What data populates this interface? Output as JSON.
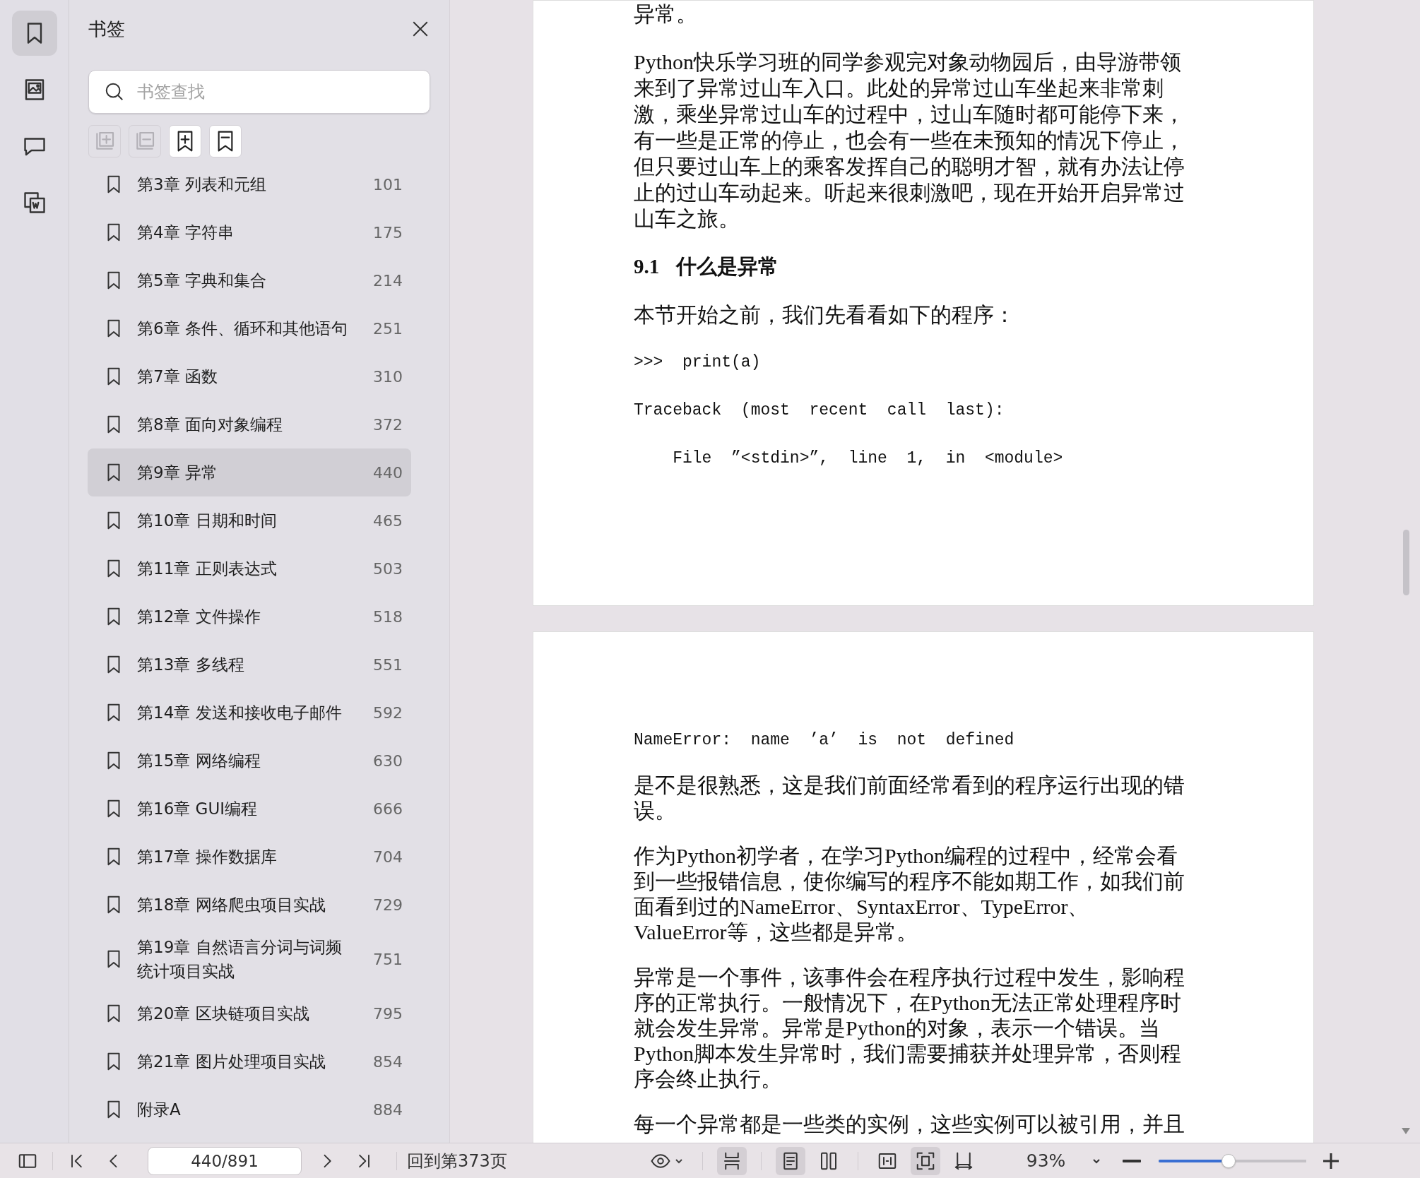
{
  "rail": [
    {
      "kind": "bookmark",
      "selected": true
    },
    {
      "kind": "image",
      "selected": false
    },
    {
      "kind": "comment",
      "selected": false
    },
    {
      "kind": "convert",
      "selected": false
    }
  ],
  "sidebar": {
    "title": "书签",
    "search": {
      "placeholder": "书签查找"
    },
    "tools": [
      {
        "kind": "expand",
        "disabled": true
      },
      {
        "kind": "collapse",
        "disabled": true
      },
      {
        "kind": "add",
        "disabled": false
      },
      {
        "kind": "remove",
        "disabled": false
      }
    ],
    "bookmarks": [
      {
        "title": "第3章 列表和元组",
        "page": "101",
        "selected": false
      },
      {
        "title": "第4章 字符串",
        "page": "175",
        "selected": false
      },
      {
        "title": "第5章 字典和集合",
        "page": "214",
        "selected": false
      },
      {
        "title": "第6章 条件、循环和其他语句",
        "page": "251",
        "selected": false
      },
      {
        "title": "第7章 函数",
        "page": "310",
        "selected": false
      },
      {
        "title": "第8章 面向对象编程",
        "page": "372",
        "selected": false
      },
      {
        "title": "第9章 异常",
        "page": "440",
        "selected": true
      },
      {
        "title": "第10章 日期和时间",
        "page": "465",
        "selected": false
      },
      {
        "title": "第11章 正则表达式",
        "page": "503",
        "selected": false
      },
      {
        "title": "第12章 文件操作",
        "page": "518",
        "selected": false
      },
      {
        "title": "第13章 多线程",
        "page": "551",
        "selected": false
      },
      {
        "title": "第14章 发送和接收电子邮件",
        "page": "592",
        "selected": false
      },
      {
        "title": "第15章 网络编程",
        "page": "630",
        "selected": false
      },
      {
        "title": "第16章 GUI编程",
        "page": "666",
        "selected": false
      },
      {
        "title": "第17章 操作数据库",
        "page": "704",
        "selected": false
      },
      {
        "title": "第18章 网络爬虫项目实战",
        "page": "729",
        "selected": false
      },
      {
        "title": "第19章 自然语言分词与词频统计项目实战",
        "page": "751",
        "selected": false
      },
      {
        "title": "第20章 区块链项目实战",
        "page": "795",
        "selected": false
      },
      {
        "title": "第21章 图片处理项目实战",
        "page": "854",
        "selected": false
      },
      {
        "title": "附录A",
        "page": "884",
        "selected": false
      }
    ]
  },
  "document": {
    "pages": [
      {
        "blocks": [
          {
            "kind": "text",
            "lines": [
              "异常。"
            ]
          },
          {
            "kind": "text",
            "lines": [
              "Python快乐学习班的同学参观完对象动物园后，由导游带领",
              "来到了异常过山车入口。此处的异常过山车坐起来非常刺",
              "激，乘坐异常过山车的过程中，过山车随时都可能停下来，",
              "有一些是正常的停止，也会有一些在未预知的情况下停止，",
              "但只要过山车上的乘客发挥自己的聪明才智，就有办法让停",
              "止的过山车动起来。听起来很刺激吧，现在开始开启异常过",
              "山车之旅。"
            ]
          },
          {
            "kind": "heading",
            "number": "9.1",
            "text": "什么是异常"
          },
          {
            "kind": "text",
            "lines": [
              "本节开始之前，我们先看看如下的程序："
            ]
          },
          {
            "kind": "code",
            "text": ">>>  print(a)"
          },
          {
            "kind": "code",
            "text": "Traceback  (most  recent  call  last):"
          },
          {
            "kind": "code",
            "text": "    File  ”<stdin>”,  line  1,  in  <module>"
          }
        ]
      },
      {
        "blocks": [
          {
            "kind": "code",
            "text": "NameError:  name  ’a’  is  not  defined"
          },
          {
            "kind": "text",
            "lines": [
              "是不是很熟悉，这是我们前面经常看到的程序运行出现的错",
              "误。"
            ]
          },
          {
            "kind": "text",
            "lines": [
              "作为Python初学者，在学习Python编程的过程中，经常会看",
              "到一些报错信息，使你编写的程序不能如期工作，如我们前",
              "面看到过的NameError、SyntaxError、TypeError、",
              "ValueError等，这些都是异常。"
            ]
          },
          {
            "kind": "text",
            "lines": [
              "异常是一个事件，该事件会在程序执行过程中发生，影响程",
              "序的正常执行。一般情况下，在Python无法正常处理程序时",
              "就会发生异常。异常是Python的对象，表示一个错误。当",
              "Python脚本发生异常时，我们需要捕获并处理异常，否则程",
              "序会终止执行。"
            ]
          },
          {
            "kind": "text",
            "lines": [
              "每一个异常都是一些类的实例，这些实例可以被引用，并且"
            ]
          }
        ]
      }
    ]
  },
  "toolbar": {
    "nav": [
      {
        "kind": "first"
      },
      {
        "kind": "prev"
      }
    ],
    "page_field": {
      "value": "440/891"
    },
    "nav_after": [
      {
        "kind": "next"
      },
      {
        "kind": "last"
      }
    ],
    "back_link": "回到第373页",
    "view_groups": [
      [
        {
          "kind": "eye",
          "selected": false
        }
      ],
      [
        {
          "kind": "continuous",
          "selected": true
        }
      ],
      [
        {
          "kind": "single",
          "selected": true
        },
        {
          "kind": "double",
          "selected": false
        }
      ],
      [
        {
          "kind": "fitwidth",
          "selected": false
        },
        {
          "kind": "fitpage",
          "selected": true
        },
        {
          "kind": "rotate",
          "selected": false
        }
      ]
    ],
    "zoom": "93%",
    "zoom_slider": {
      "level": 0.47
    }
  }
}
